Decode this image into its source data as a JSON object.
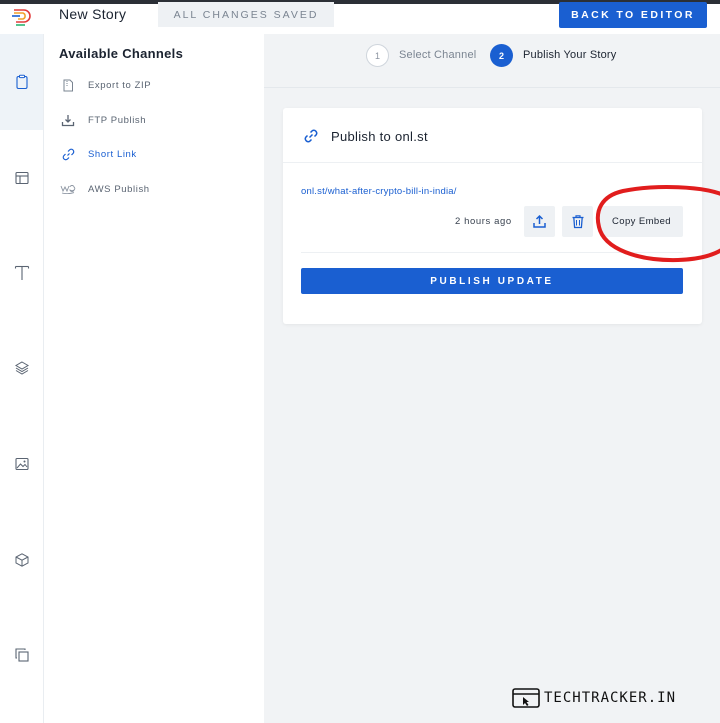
{
  "header": {
    "story_title": "New Story",
    "save_status": "ALL CHANGES SAVED",
    "back_label": "BACK TO EDITOR"
  },
  "rail": {
    "items": [
      "clipboard-icon",
      "layout-icon",
      "text-icon",
      "layers-icon",
      "image-icon",
      "cube-icon",
      "copy-icon"
    ]
  },
  "channels": {
    "title": "Available Channels",
    "items": [
      {
        "label": "Export to ZIP",
        "icon": "zip-file-icon"
      },
      {
        "label": "FTP Publish",
        "icon": "ftp-upload-icon"
      },
      {
        "label": "Short Link",
        "icon": "link-icon",
        "selected": true
      },
      {
        "label": "AWS Publish",
        "icon": "aws-icon"
      }
    ]
  },
  "steps": [
    {
      "number": "1",
      "label": "Select Channel",
      "state": "idle"
    },
    {
      "number": "2",
      "label": "Publish Your Story",
      "state": "current"
    }
  ],
  "card": {
    "title": "Publish to onl.st",
    "url": "onl.st/what-after-crypto-bill-in-india/",
    "time_ago": "2 hours ago",
    "copy_embed_label": "Copy Embed",
    "publish_label": "PUBLISH UPDATE"
  },
  "watermark": {
    "text": "TECHTRACKER.IN"
  },
  "colors": {
    "accent": "#1a5fd1",
    "annotation": "#e11d1d",
    "panel_bg": "#f1f3f5"
  }
}
